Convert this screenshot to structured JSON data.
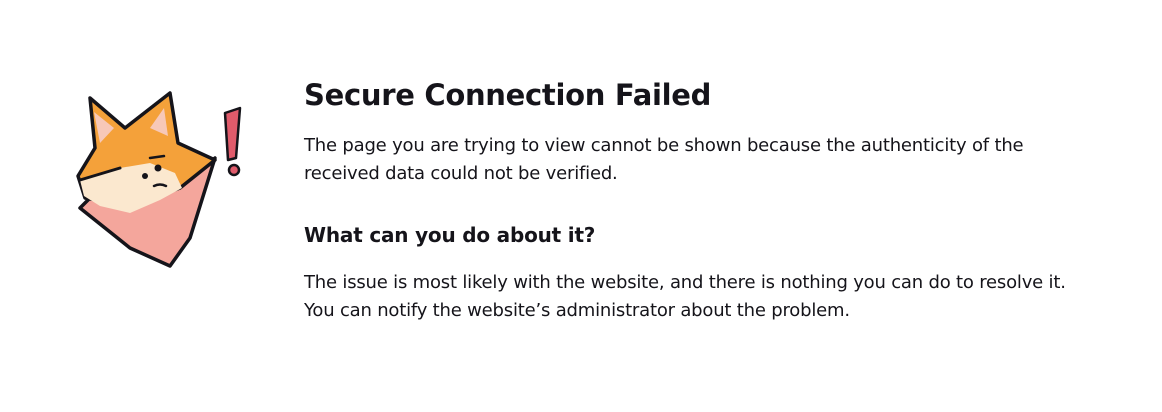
{
  "error": {
    "title": "Secure Connection Failed",
    "description": "The page you are trying to view cannot be shown because the authenticity of the received data could not be verified.",
    "help_heading": "What can you do about it?",
    "help_text": "The issue is most likely with the website, and there is nothing you can do to resolve it. You can notify the website’s administrator about the problem."
  },
  "illustration": {
    "icon": "fox-warning-icon",
    "colors": {
      "fur": "#f4a13a",
      "cheek": "#fbe8cf",
      "body": "#f4a69c",
      "inner_ear": "#f7c8b8",
      "outline": "#15141a",
      "exclamation": "#e05b6b"
    }
  }
}
